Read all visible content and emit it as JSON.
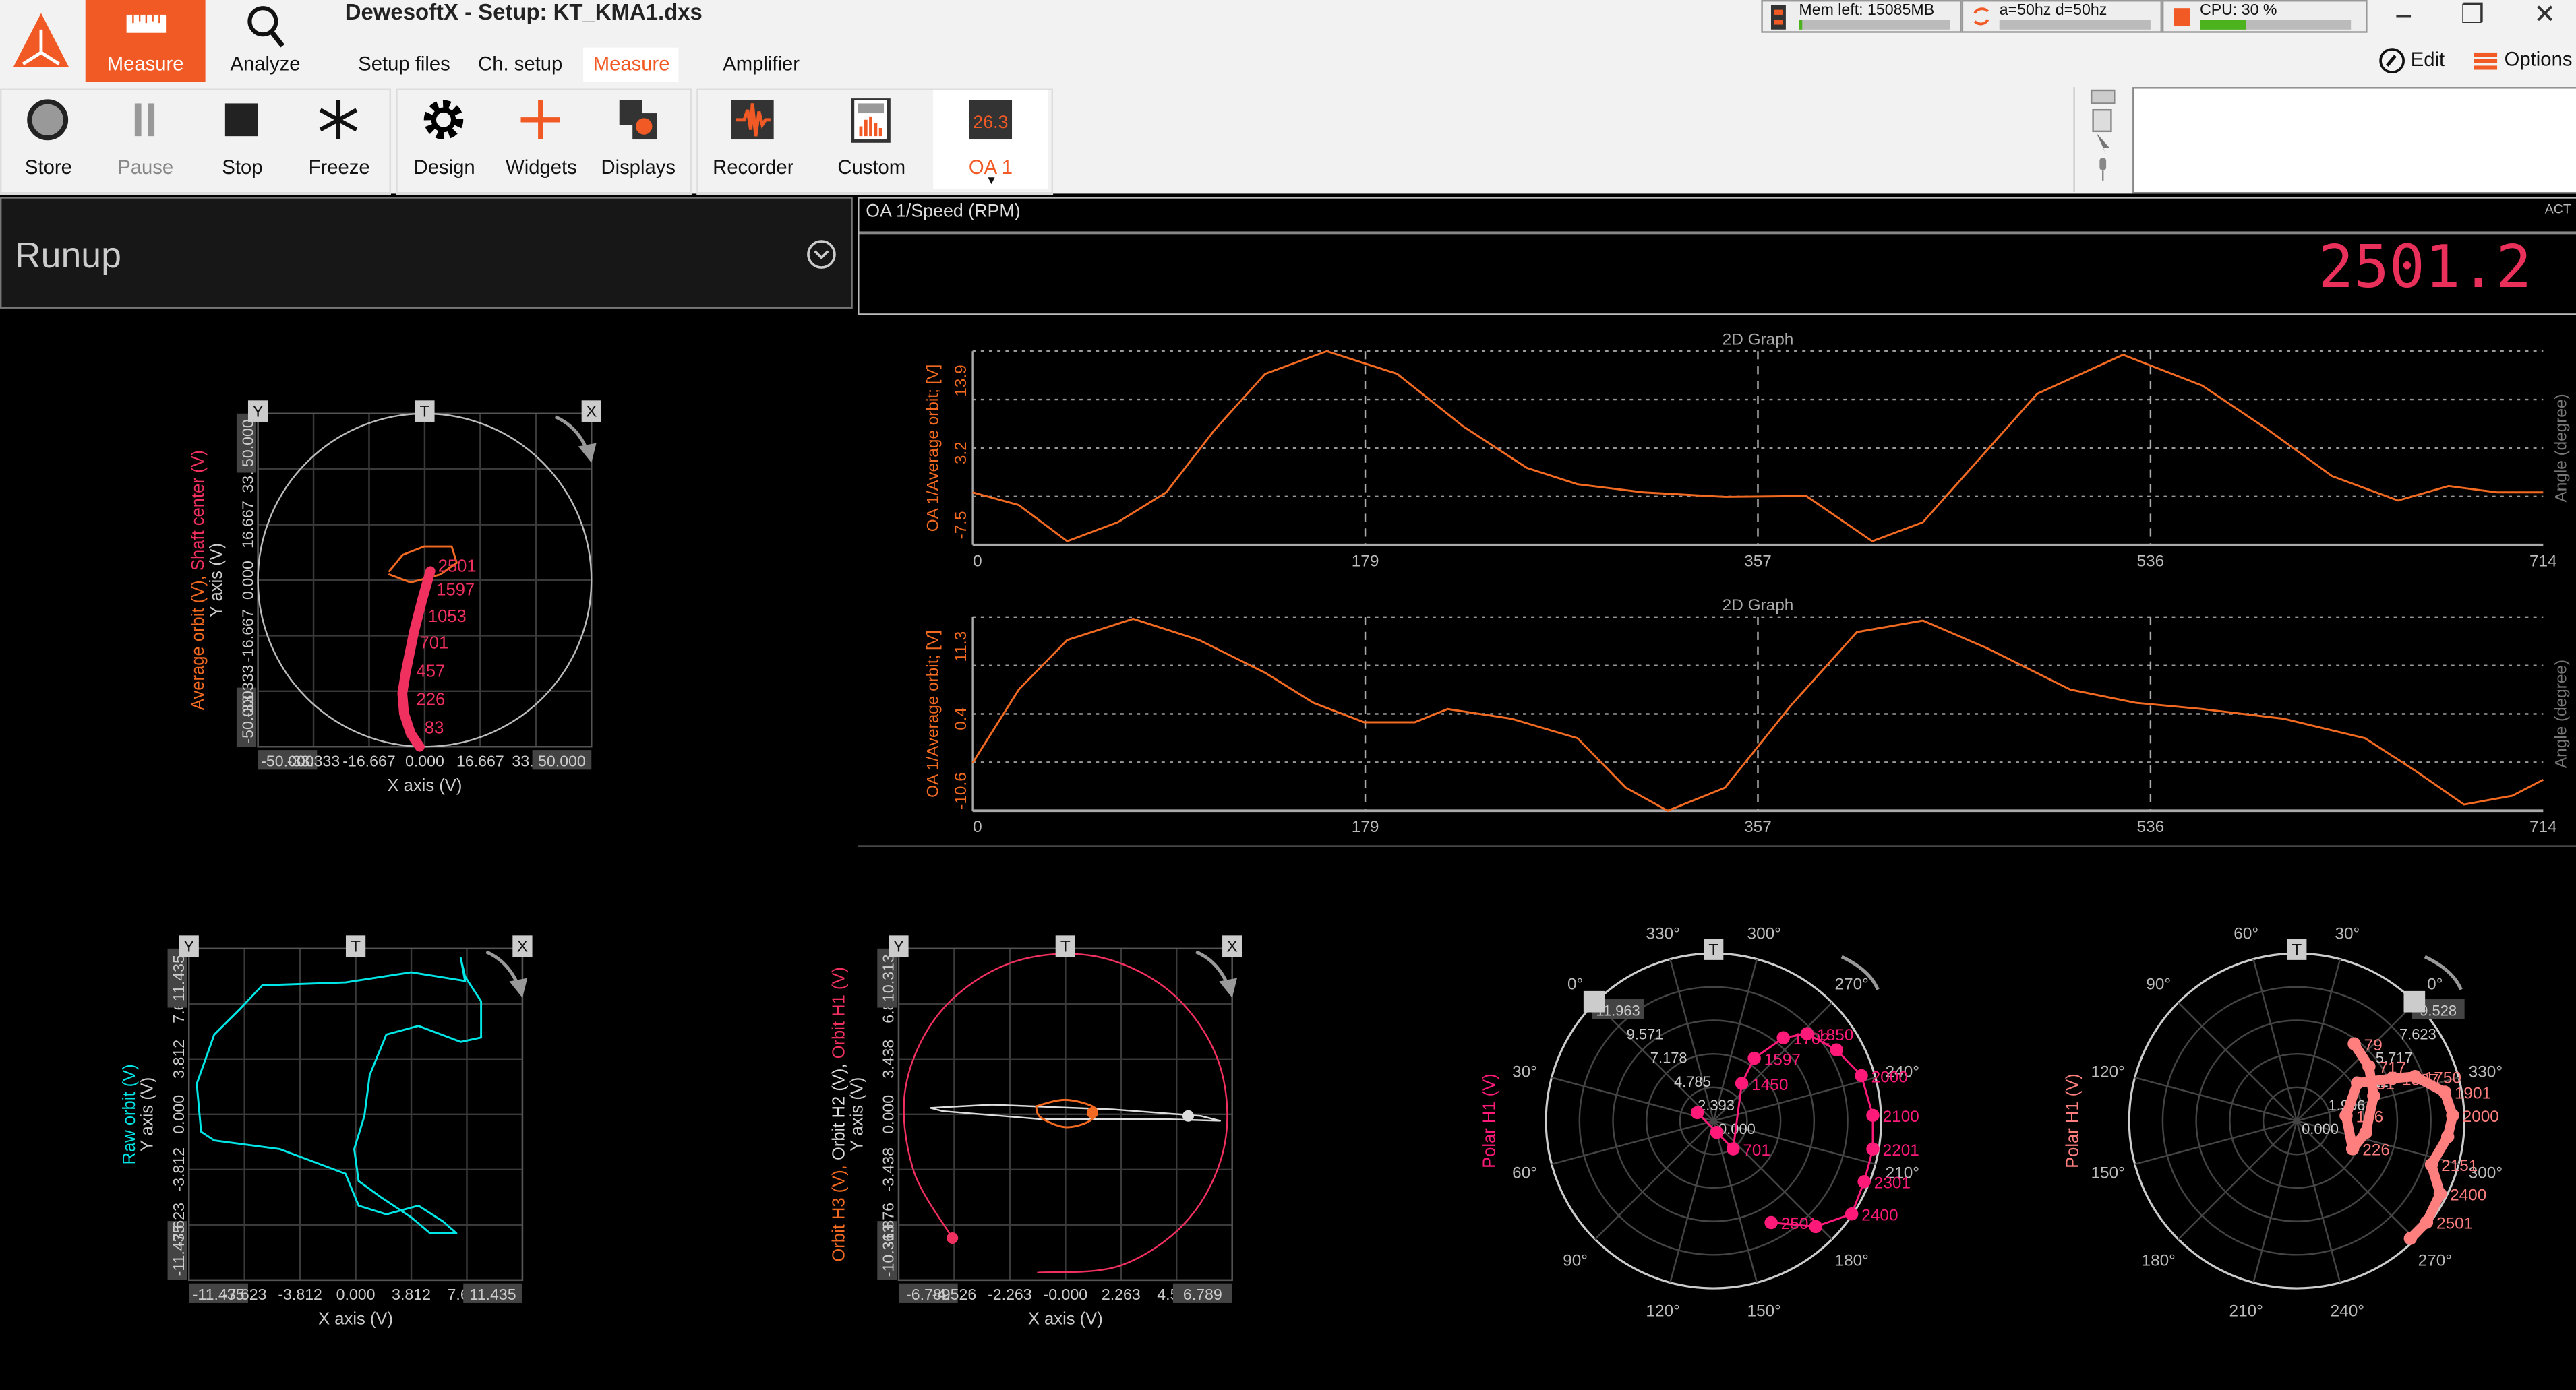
{
  "app": {
    "title": "DewesoftX - Setup: KT_KMA1.dxs",
    "logo": "dewesoft-logo"
  },
  "nav": {
    "measure": "Measure",
    "analyze": "Analyze"
  },
  "tabs": [
    {
      "label": "Setup files"
    },
    {
      "label": "Ch. setup"
    },
    {
      "label": "Measure",
      "active": true
    },
    {
      "label": "Amplifier"
    }
  ],
  "toolbar": [
    {
      "label": "Store",
      "icon": "record-icon"
    },
    {
      "label": "Pause",
      "icon": "pause-icon",
      "disabled": true
    },
    {
      "label": "Stop",
      "icon": "stop-icon"
    },
    {
      "label": "Freeze",
      "icon": "snowflake-icon"
    },
    {
      "label": "Design",
      "icon": "gear-icon"
    },
    {
      "label": "Widgets",
      "icon": "plus-icon"
    },
    {
      "label": "Displays",
      "icon": "displays-icon"
    },
    {
      "label": "Recorder",
      "icon": "recorder-icon"
    },
    {
      "label": "Custom",
      "icon": "custom-screen-icon"
    },
    {
      "label": "OA 1",
      "icon": "digital-meter-icon",
      "selected": true,
      "icon_text": "26.3"
    }
  ],
  "status": {
    "mem": "Mem left: 15085MB",
    "mem_used_percent": 2,
    "rate": "a=50hz d=50hz",
    "cpu": "CPU: 30 %",
    "cpu_percent": 30
  },
  "header_right": {
    "edit": "Edit",
    "options": "Options"
  },
  "runup": {
    "title": "Runup"
  },
  "meter": {
    "channel": "OA 1/Speed (RPM)",
    "mode": "ACT",
    "value": "2501.2"
  },
  "colors": {
    "accent": "#f15a24",
    "orange": "#f26a21",
    "pink": "#f0305f",
    "magenta": "#ff1a7a",
    "salmon": "#ff7f7f",
    "cyan": "#00e5e5",
    "grid": "#3a3a3a",
    "meter": "#e8305a"
  },
  "chart_data": [
    {
      "type": "line",
      "title": "2D Graph",
      "ylabel": "OA 1/Average orbit; [V]",
      "ylabel_right": "Angle (degree)",
      "ylim": [
        -7.5,
        13.9
      ],
      "yticks": [
        "13.9",
        "3.2",
        "-7.5"
      ],
      "xlim": [
        0,
        714
      ],
      "xticks": [
        "0",
        "179",
        "357",
        "536",
        "714"
      ],
      "grid": true,
      "x": [
        0,
        21,
        43,
        66,
        88,
        110,
        133,
        161,
        193,
        223,
        252,
        275,
        305,
        342,
        379,
        409,
        432,
        454,
        484,
        523,
        559,
        589,
        618,
        648,
        671,
        693,
        714
      ],
      "y": [
        -1.7,
        -3.1,
        -7.1,
        -5.0,
        -1.7,
        5.2,
        11.4,
        13.9,
        11.4,
        5.6,
        1.0,
        -0.8,
        -1.7,
        -2.2,
        -2.1,
        -7.1,
        -5.0,
        1.0,
        9.2,
        13.5,
        10.1,
        5.2,
        0.1,
        -2.6,
        -1.0,
        -1.7,
        -1.7
      ]
    },
    {
      "type": "line",
      "title": "2D Graph",
      "ylabel": "OA 1/Average orbit; [V]",
      "ylabel_right": "Angle (degree)",
      "ylim": [
        -10.6,
        11.3
      ],
      "yticks": [
        "11.3",
        "0.4",
        "-10.6"
      ],
      "xlim": [
        0,
        714
      ],
      "xticks": [
        "0",
        "179",
        "357",
        "536",
        "714"
      ],
      "grid": true,
      "x": [
        0,
        21,
        43,
        73,
        103,
        133,
        155,
        178,
        201,
        216,
        245,
        275,
        297,
        316,
        342,
        372,
        402,
        432,
        461,
        499,
        529,
        559,
        596,
        633,
        656,
        678,
        700,
        714
      ],
      "y": [
        -5.2,
        3.1,
        8.7,
        11.1,
        8.7,
        5.0,
        1.6,
        -0.6,
        -0.6,
        0.9,
        -0.2,
        -2.4,
        -8.0,
        -10.6,
        -8.0,
        1.3,
        9.6,
        10.9,
        7.8,
        3.1,
        1.6,
        0.9,
        -0.2,
        -2.4,
        -6.1,
        -9.9,
        -8.9,
        -7.1
      ]
    },
    {
      "type": "scatter",
      "subtype": "orbit",
      "xlabel": "X axis (V)",
      "ylabel": "Y axis (V)",
      "legend": [
        {
          "text": "Average orbit (V), ",
          "color": "#f26a21"
        },
        {
          "text": "Shaft center (V)",
          "color": "#f0305f"
        }
      ],
      "xlim": [
        -50,
        50
      ],
      "ylim": [
        -50,
        50
      ],
      "xticks": [
        "-50.000",
        "-33.333",
        "-16.667",
        "0.000",
        "16.667",
        "33.333",
        "50.000"
      ],
      "yticks": [
        "-50.000",
        "-33.333",
        "-16.667",
        "0.000",
        "16.667",
        "33.333",
        "50.000"
      ],
      "markers": [
        "Y",
        "T",
        "X"
      ],
      "boundary_circle": 50,
      "series": [
        {
          "color": "#f26a21",
          "width": 1.2,
          "points": [
            [
              -10.6,
              2.7
            ],
            [
              -6.6,
              7.6
            ],
            [
              -0.2,
              10.1
            ],
            [
              8.1,
              10.1
            ],
            [
              9.6,
              5.2
            ],
            [
              4.7,
              1.7
            ],
            [
              -4.2,
              -0.7
            ],
            [
              -10.6,
              1.7
            ]
          ]
        },
        {
          "color": "#f0305f",
          "width": 6,
          "points": [
            [
              -1.5,
              -50
            ],
            [
              -4.2,
              -46
            ],
            [
              -6.2,
              -40
            ],
            [
              -6.7,
              -34
            ],
            [
              -5.7,
              -27.8
            ],
            [
              -3.2,
              -15.5
            ],
            [
              -0.7,
              -5.7
            ],
            [
              1.7,
              2.7
            ]
          ],
          "labels": [
            {
              "text": "2501",
              "x": 4,
              "y": 2.5
            },
            {
              "text": "1597",
              "x": 3.5,
              "y": -4.5
            },
            {
              "text": "1053",
              "x": 1,
              "y": -12.5
            },
            {
              "text": "701",
              "x": -1.5,
              "y": -20.5
            },
            {
              "text": "457",
              "x": -2.5,
              "y": -29
            },
            {
              "text": "226",
              "x": -2.5,
              "y": -37.5
            },
            {
              "text": "83",
              "x": 0,
              "y": -46
            }
          ]
        }
      ]
    },
    {
      "type": "scatter",
      "subtype": "orbit",
      "xlabel": "X axis (V)",
      "ylabel": "Y axis (V)",
      "legend": [
        {
          "text": "Raw orbit (V)",
          "color": "#00e5e5"
        }
      ],
      "xlim": [
        -11.435,
        11.435
      ],
      "ylim": [
        -11.435,
        11.435
      ],
      "xticks": [
        "-11.435",
        "-7.623",
        "-3.812",
        "0.000",
        "3.812",
        "7.623",
        "11.435"
      ],
      "yticks": [
        "-11.435",
        "-7.623",
        "-3.812",
        "0.000",
        "3.812",
        "7.623",
        "11.435"
      ],
      "markers": [
        "Y",
        "T",
        "X"
      ],
      "series": [
        {
          "color": "#00e5e5",
          "width": 1.2,
          "points": [
            [
              7.2,
              10.8
            ],
            [
              7.5,
              9.2
            ],
            [
              3.8,
              9.8
            ],
            [
              -0.7,
              9.1
            ],
            [
              -6.4,
              8.9
            ],
            [
              -8.0,
              7.2
            ],
            [
              -9.7,
              5.5
            ],
            [
              -10.9,
              2.1
            ],
            [
              -10.6,
              -1.2
            ],
            [
              -9.7,
              -1.8
            ],
            [
              -5.2,
              -2.4
            ],
            [
              -0.7,
              -4.1
            ],
            [
              0.2,
              -6.3
            ],
            [
              2.1,
              -6.9
            ],
            [
              4.3,
              -6.3
            ],
            [
              6.0,
              -7.4
            ],
            [
              6.9,
              -8.2
            ],
            [
              5.1,
              -8.2
            ],
            [
              3.8,
              -7.1
            ],
            [
              1.7,
              -5.7
            ],
            [
              0.2,
              -4.6
            ],
            [
              -0.1,
              -2.4
            ],
            [
              0.6,
              -0.1
            ],
            [
              0.96,
              2.7
            ],
            [
              2.1,
              5.5
            ],
            [
              4.3,
              6.1
            ],
            [
              7.2,
              5.0
            ],
            [
              8.6,
              5.3
            ],
            [
              8.6,
              7.8
            ],
            [
              7.5,
              9.5
            ],
            [
              7.2,
              10.8
            ]
          ]
        }
      ]
    },
    {
      "type": "scatter",
      "subtype": "orbit",
      "xlabel": "X axis (V)",
      "ylabel": "Y axis (V)",
      "legend": [
        {
          "text": "Orbit H3 (V), ",
          "color": "#f26a21"
        },
        {
          "text": "Orbit H2 (V), ",
          "color": "#dddddd"
        },
        {
          "text": "Orbit H1 (V)",
          "color": "#f0305f"
        }
      ],
      "xlim": [
        -6.789,
        6.789
      ],
      "ylim": [
        -10.313,
        10.313
      ],
      "xticks": [
        "-6.789",
        "-4.526",
        "-2.263",
        "-0.000",
        "2.263",
        "4.526",
        "6.789"
      ],
      "yticks": [
        "-10.313",
        "-6.876",
        "-3.438",
        "0.000",
        "3.438",
        "6.876",
        "10.313"
      ],
      "markers": [
        "Y",
        "T",
        "X"
      ],
      "series": [
        {
          "color": "#f0305f",
          "width": 1,
          "smooth": true,
          "points": [
            [
              -1.15,
              -9.85
            ],
            [
              2.26,
              -9.4
            ],
            [
              5.06,
              -6.43
            ],
            [
              6.5,
              -1.74
            ],
            [
              6.2,
              3.42
            ],
            [
              4.24,
              7.66
            ],
            [
              1.15,
              9.85
            ],
            [
              -2.26,
              9.4
            ],
            [
              -5.06,
              6.43
            ],
            [
              -6.5,
              1.74
            ],
            [
              -6.2,
              -3.42
            ],
            [
              -4.6,
              -7.7
            ]
          ],
          "end_dot": [
            -4.6,
            -7.7
          ]
        },
        {
          "color": "#dddddd",
          "width": 1,
          "points": [
            [
              -5.5,
              0.4
            ],
            [
              -3,
              0.6
            ],
            [
              2,
              0.3
            ],
            [
              5.5,
              -0.1
            ],
            [
              6.3,
              -0.4
            ],
            [
              4,
              -0.3
            ],
            [
              -1,
              -0.3
            ],
            [
              -5,
              0.2
            ],
            [
              -5.5,
              0.4
            ]
          ],
          "end_dot": [
            5.0,
            -0.1
          ]
        },
        {
          "color": "#f26a21",
          "width": 1.2,
          "smooth": true,
          "points": [
            [
              -1.2,
              0.5
            ],
            [
              0,
              0.9
            ],
            [
              1.2,
              0.4
            ],
            [
              1.0,
              -0.4
            ],
            [
              0,
              -0.8
            ],
            [
              -1.0,
              -0.2
            ],
            [
              -1.2,
              0.5
            ]
          ],
          "end_dot": [
            1.1,
            0.1
          ]
        }
      ]
    },
    {
      "type": "scatter",
      "subtype": "polar",
      "ylabel": "Polar H1 (V)",
      "color": "#ff1a7a",
      "rmax": 11.963,
      "rings": [
        "2.393",
        "4.785",
        "7.178",
        "9.571",
        "11.963"
      ],
      "center_label": "0.000",
      "angle_labels": [
        "0°",
        "30°",
        "60°",
        "90°",
        "120°",
        "150°",
        "180°",
        "210°",
        "240°",
        "270°",
        "300°",
        "330°"
      ],
      "marker": "T",
      "points": [
        {
          "rpm": "",
          "amp": 1.3,
          "phase": 18
        },
        {
          "rpm": "",
          "amp": 0.86,
          "phase": 151
        },
        {
          "rpm": "701",
          "amp": 2.44,
          "phase": 170
        },
        {
          "rpm": "1450",
          "amp": 3.35,
          "phase": 278
        },
        {
          "rpm": "1597",
          "amp": 5.34,
          "phase": 282
        },
        {
          "rpm": "1702",
          "amp": 7.75,
          "phase": 275
        },
        {
          "rpm": "1850",
          "amp": 9.13,
          "phase": 268
        },
        {
          "rpm": "",
          "amp": 10.14,
          "phase": 255
        },
        {
          "rpm": "2000",
          "amp": 11.04,
          "phase": 242
        },
        {
          "rpm": "2100",
          "amp": 11.38,
          "phase": 227
        },
        {
          "rpm": "2201",
          "amp": 11.55,
          "phase": 215
        },
        {
          "rpm": "2301",
          "amp": 11.6,
          "phase": 203
        },
        {
          "rpm": "2400",
          "amp": 11.9,
          "phase": 191
        },
        {
          "rpm": "",
          "amp": 10.5,
          "phase": 179
        },
        {
          "rpm": "2501",
          "amp": 8.35,
          "phase": 164.5
        }
      ]
    },
    {
      "type": "scatter",
      "subtype": "polar",
      "ylabel": "Polar H1 (V)",
      "color": "#ff7f7f",
      "rmax": 9.528,
      "rings": [
        "1.906",
        "3.811",
        "5.717",
        "7.623",
        "9.528"
      ],
      "center_label": "0.000",
      "angle_labels": [
        "0°",
        "30°",
        "60°",
        "90°",
        "120°",
        "150°",
        "180°",
        "210°",
        "240°",
        "270°",
        "300°",
        "330°"
      ],
      "marker": "T",
      "points": [
        {
          "rpm": "79",
          "amp": 5.47,
          "phase": 8.3
        },
        {
          "rpm": "717",
          "amp": 5.14,
          "phase": 352
        },
        {
          "rpm": "",
          "amp": 4.6,
          "phase": 333
        },
        {
          "rpm": "",
          "amp": 3.98,
          "phase": 305.5
        },
        {
          "rpm": "226",
          "amp": 3.55,
          "phase": 288.5
        },
        {
          "rpm": "106",
          "amp": 2.82,
          "phase": 321
        },
        {
          "rpm": "151",
          "amp": 4.07,
          "phase": 347
        },
        {
          "rpm": "1597",
          "amp": 5.94,
          "phase": 339
        },
        {
          "rpm": "1750",
          "amp": 7.18,
          "phase": 335.6
        },
        {
          "rpm": "1901",
          "amp": 8.57,
          "phase": 326
        },
        {
          "rpm": "2000",
          "amp": 8.87,
          "phase": 317
        },
        {
          "rpm": "",
          "amp": 8.63,
          "phase": 309
        },
        {
          "rpm": "2151",
          "amp": 8.05,
          "phase": 297
        },
        {
          "rpm": "2400",
          "amp": 9.15,
          "phase": 288
        },
        {
          "rpm": "2501",
          "amp": 9.37,
          "phase": 277
        },
        {
          "rpm": "",
          "amp": 9.3,
          "phase": 269
        }
      ]
    }
  ]
}
